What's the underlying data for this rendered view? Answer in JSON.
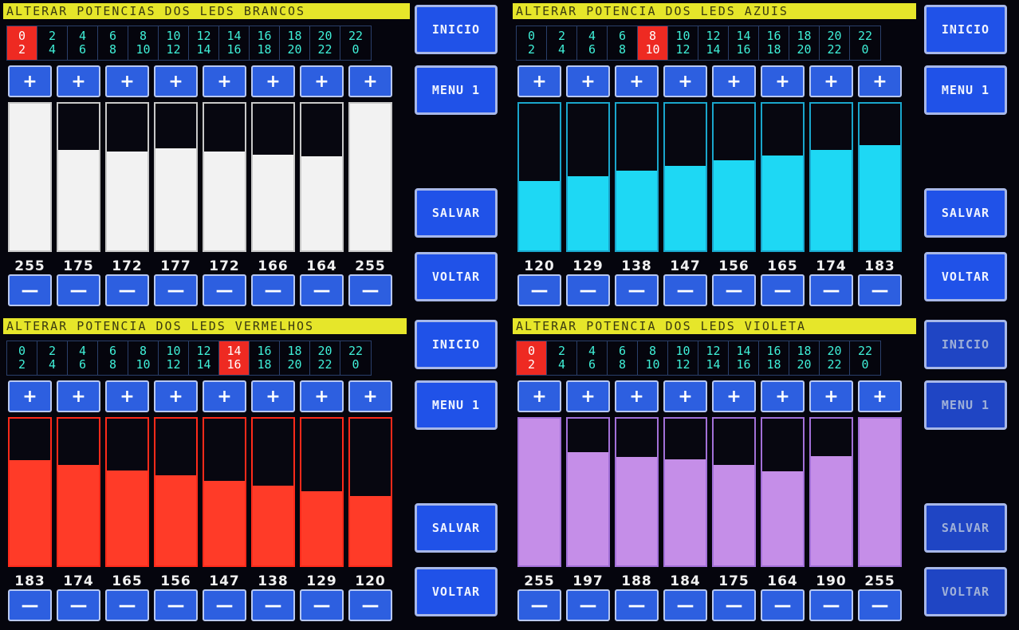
{
  "tabs": [
    {
      "top": "0",
      "bottom": "2"
    },
    {
      "top": "2",
      "bottom": "4"
    },
    {
      "top": "4",
      "bottom": "6"
    },
    {
      "top": "6",
      "bottom": "8"
    },
    {
      "top": "8",
      "bottom": "10"
    },
    {
      "top": "10",
      "bottom": "12"
    },
    {
      "top": "12",
      "bottom": "14"
    },
    {
      "top": "14",
      "bottom": "16"
    },
    {
      "top": "16",
      "bottom": "18"
    },
    {
      "top": "18",
      "bottom": "20"
    },
    {
      "top": "20",
      "bottom": "22"
    },
    {
      "top": "22",
      "bottom": "0"
    }
  ],
  "plus_label": "+",
  "minus_label": "—",
  "side_buttons": {
    "inicio": "INICIO",
    "menu": "MENU 1",
    "salvar": "SALVAR",
    "voltar": "VOLTAR"
  },
  "panels": [
    {
      "id": "brancos",
      "title": "ALTERAR POTENCIAS DOS LEDS BRANCOS",
      "selected_tab": 0,
      "colors": {
        "fill": "#f2f2f2",
        "border": "#c8c8c8"
      },
      "levels": [
        "255",
        "175",
        "172",
        "177",
        "172",
        "166",
        "164",
        "255"
      ]
    },
    {
      "id": "azuis",
      "title": "ALTERAR POTENCIA DOS LEDS AZUIS",
      "selected_tab": 4,
      "colors": {
        "fill": "#1ed8f4",
        "border": "#1aa6cc"
      },
      "levels": [
        "120",
        "129",
        "138",
        "147",
        "156",
        "165",
        "174",
        "183"
      ]
    },
    {
      "id": "vermelhos",
      "title": "ALTERAR POTENCIA DOS LEDS VERMELHOS",
      "selected_tab": 7,
      "colors": {
        "fill": "#ff3b28",
        "border": "#ff2a1a"
      },
      "levels": [
        "183",
        "174",
        "165",
        "156",
        "147",
        "138",
        "129",
        "120"
      ]
    },
    {
      "id": "violeta",
      "title": "ALTERAR POTENCIA DOS LEDS VIOLETA",
      "selected_tab": 0,
      "colors": {
        "fill": "#c58ee8",
        "border": "#a270d8"
      },
      "levels": [
        "255",
        "197",
        "188",
        "184",
        "175",
        "164",
        "190",
        "255"
      ]
    }
  ]
}
